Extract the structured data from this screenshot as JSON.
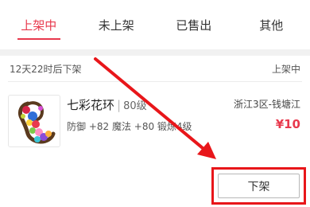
{
  "tabs": [
    {
      "label": "上架中",
      "active": true
    },
    {
      "label": "未上架",
      "active": false
    },
    {
      "label": "已售出",
      "active": false
    },
    {
      "label": "其他",
      "active": false
    }
  ],
  "listing": {
    "time_remaining": "12天22时后下架",
    "status": "上架中",
    "item_name": "七彩花环",
    "item_level": "80级",
    "server": "浙江3区-钱塘江",
    "attributes": "防御 +82 魔法 +80 锻炼4级",
    "price": "¥10",
    "delist_button_label": "下架"
  },
  "colors": {
    "accent": "#e8394d",
    "annotation": "#e8161a"
  }
}
